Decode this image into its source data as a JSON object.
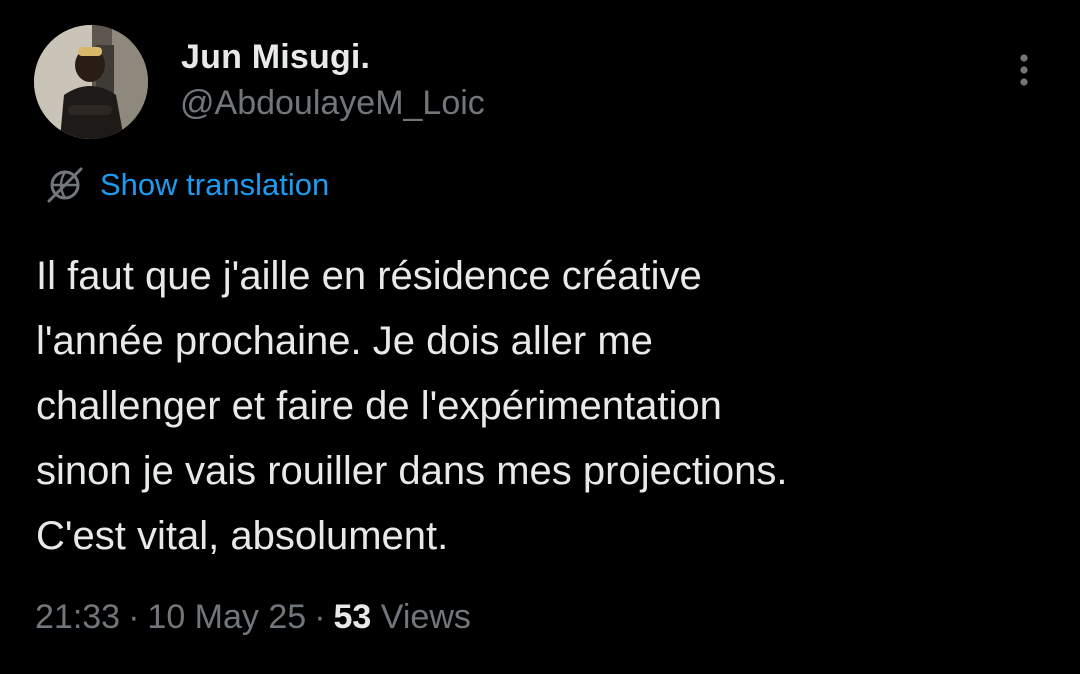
{
  "tweet": {
    "author": {
      "display_name": "Jun Misugi.",
      "handle": "@AbdoulayeM_Loic"
    },
    "more_icon": "more-vertical-icon",
    "translation": {
      "icon": "globe-icon",
      "label": "Show translation",
      "color": "#1d9bf0"
    },
    "text_lines": [
      "Il faut que j'aille en résidence créative",
      "l'année prochaine. Je dois aller me",
      "challenger et faire de l'expérimentation",
      "sinon je vais rouiller dans mes projections.",
      "C'est vital, absolument."
    ],
    "meta": {
      "time": "21:33",
      "separator": "·",
      "date": "10 May 25",
      "views_count": "53",
      "views_label": "Views"
    }
  },
  "colors": {
    "background": "#000000",
    "primary_text": "#e7e9ea",
    "secondary_text": "#71767b",
    "link": "#1d9bf0"
  }
}
